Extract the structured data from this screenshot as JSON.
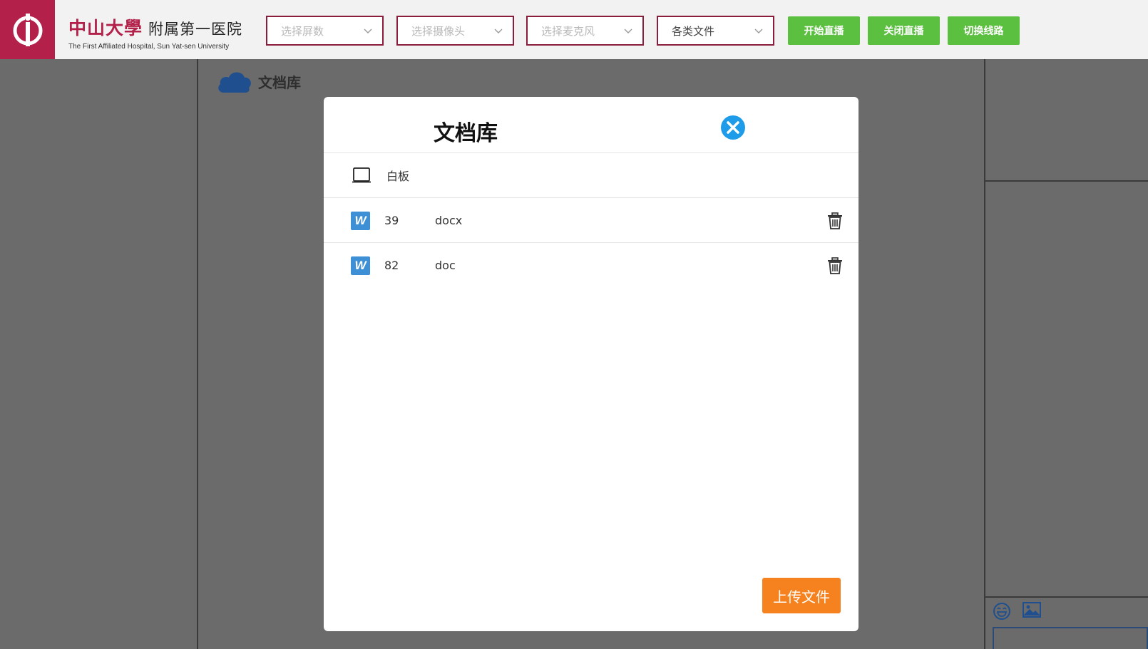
{
  "header": {
    "brand_cn": "中山大學",
    "brand_cn_2": "附属第一医院",
    "brand_en": "The First Affiliated Hospital, Sun Yat-sen University",
    "selects": [
      {
        "label": "选择屏数",
        "is_placeholder": true
      },
      {
        "label": "选择摄像头",
        "is_placeholder": true
      },
      {
        "label": "选择麦克风",
        "is_placeholder": true
      },
      {
        "label": "各类文件",
        "is_placeholder": false
      }
    ],
    "buttons": {
      "start_live": "开始直播",
      "stop_live": "关闭直播",
      "switch_line": "切换线路"
    }
  },
  "library": {
    "title": "文档库"
  },
  "modal": {
    "title": "文档库",
    "whiteboard_label": "白板",
    "files": [
      {
        "icon_letter": "W",
        "name": "39",
        "ext": "docx"
      },
      {
        "icon_letter": "W",
        "name": "82",
        "ext": "doc"
      }
    ],
    "upload_label": "上传文件"
  },
  "colors": {
    "brand": "#b3214a",
    "green_button": "#5bbf3f",
    "upload_button": "#f5821f",
    "close_icon": "#1e9be9",
    "word_icon": "#3d8fd6",
    "backdrop": "#6b6b6b"
  },
  "icons": {
    "logo": "hospital-logo-icon",
    "chevron": "chevron-down-icon",
    "cloud": "cloud-icon",
    "close": "close-circle-icon",
    "whiteboard": "whiteboard-icon",
    "word": "word-doc-icon",
    "delete": "trash-icon",
    "emoji": "emoji-icon",
    "image": "image-icon"
  }
}
